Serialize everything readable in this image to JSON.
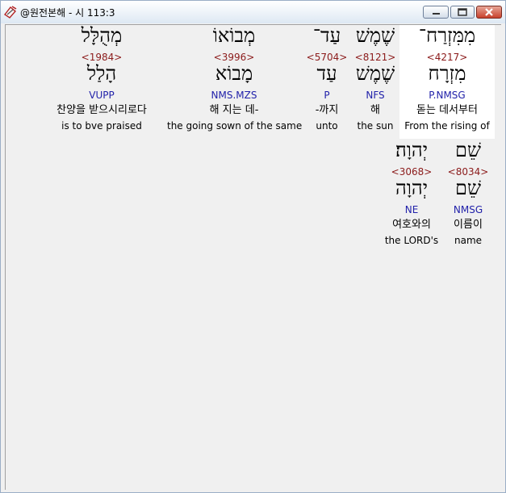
{
  "window": {
    "title": "@원전본해 - 시 113:3",
    "icon": "app-tool-icon",
    "buttons": [
      "minimize-icon",
      "maximize-icon",
      "close-icon"
    ]
  },
  "colors": {
    "strong_number": "#8b1a1a",
    "grammar_code": "#2222aa",
    "text": "#000000",
    "background": "#f0f0f0"
  },
  "row1": [
    {
      "surface": "מִמִּזְרַח־",
      "strong": "<4217>",
      "lemma": "מִזְרָח",
      "grammar": "P.NMSG",
      "korean": "돋는 데서부터",
      "english": "From the rising of"
    },
    {
      "surface": "שֶׁמֶשׁ",
      "strong": "<8121>",
      "lemma": "שֶׁמֶשׁ",
      "grammar": "NFS",
      "korean": "해",
      "english": "the sun"
    },
    {
      "surface": "עַד־",
      "strong": "<5704>",
      "lemma": "עַד",
      "grammar": "P",
      "korean": "-까지",
      "english": "unto"
    },
    {
      "surface": "מְבוֹאוֹ",
      "strong": "<3996>",
      "lemma": "מָבוֹא",
      "grammar": "NMS.MZS",
      "korean": "해 지는 데-",
      "english": "the going sown of the same"
    },
    {
      "surface": "מְהֻלָּל",
      "strong": "<1984>",
      "lemma": "הָלַל",
      "grammar": "VUPP",
      "korean": "찬양을 받으시리로다",
      "english": "is to bve praised"
    }
  ],
  "row2": [
    {
      "surface": "שֵׁם",
      "strong": "<8034>",
      "lemma": "שֵׁם",
      "grammar": "NMSG",
      "korean": "이름이",
      "english": "name"
    },
    {
      "surface": "יְהוָה׃",
      "strong": "<3068>",
      "lemma": "יְהוָה",
      "grammar": "NE",
      "korean": "여호와의",
      "english": "the LORD's"
    }
  ]
}
